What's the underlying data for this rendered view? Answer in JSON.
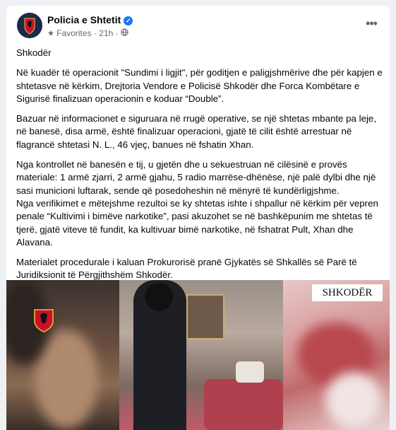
{
  "post": {
    "page_name": "Policia e Shtetit",
    "audience": "Favorites",
    "time": "21h",
    "more_icon": "more-horizontal-icon",
    "paragraphs": [
      "Shkodër",
      "Në kuadër të operacionit \"Sundimi i ligjit\", për goditjen e paligjshmërive dhe për kapjen e shtetasve në kërkim, Drejtoria Vendore e Policisë Shkodër dhe Forca Kombëtare e Sigurisë  finalizuan operacionin e koduar “Double”.",
      "Bazuar në informacionet e siguruara në rrugë operative, se një shtetas mbante pa leje, në banesë, disa armë, është finalizuar operacioni, gjatë të cilit është arrestuar në flagrancë shtetasi N. L., 46 vjeç, banues në fshatin Xhan.",
      "Nga kontrollet në banesën e tij, u gjetën dhe u sekuestruan në cilësinë e provës materiale: 1 armë zjarri, 2 armë gjahu, 5 radio marrëse-dhënëse, një palë dylbi dhe një sasi municioni luftarak, sende që posedoheshin në mënyrë të kundërligjshme.\nNga verifikimet e mëtejshme rezultoi se ky shtetas ishte i shpallur në kërkim për vepren penale “Kultivimi i bimëve narkotike”, pasi akuzohet se në bashkëpunim me shtetas të tjerë, gjatë viteve të fundit, ka kultivuar bimë narkotike, në fshatrat Pult, Xhan dhe Alavana.",
      "Materialet procedurale i kaluan Prokurorisë pranë Gjykatës së Shkallës së Parë të Juridiksionit të Përgjithshëm Shkodër."
    ],
    "media_label": "SHKODËR"
  },
  "colors": {
    "verified": "#1877f2",
    "meta_text": "#65676b",
    "background": "#eef0f3"
  }
}
